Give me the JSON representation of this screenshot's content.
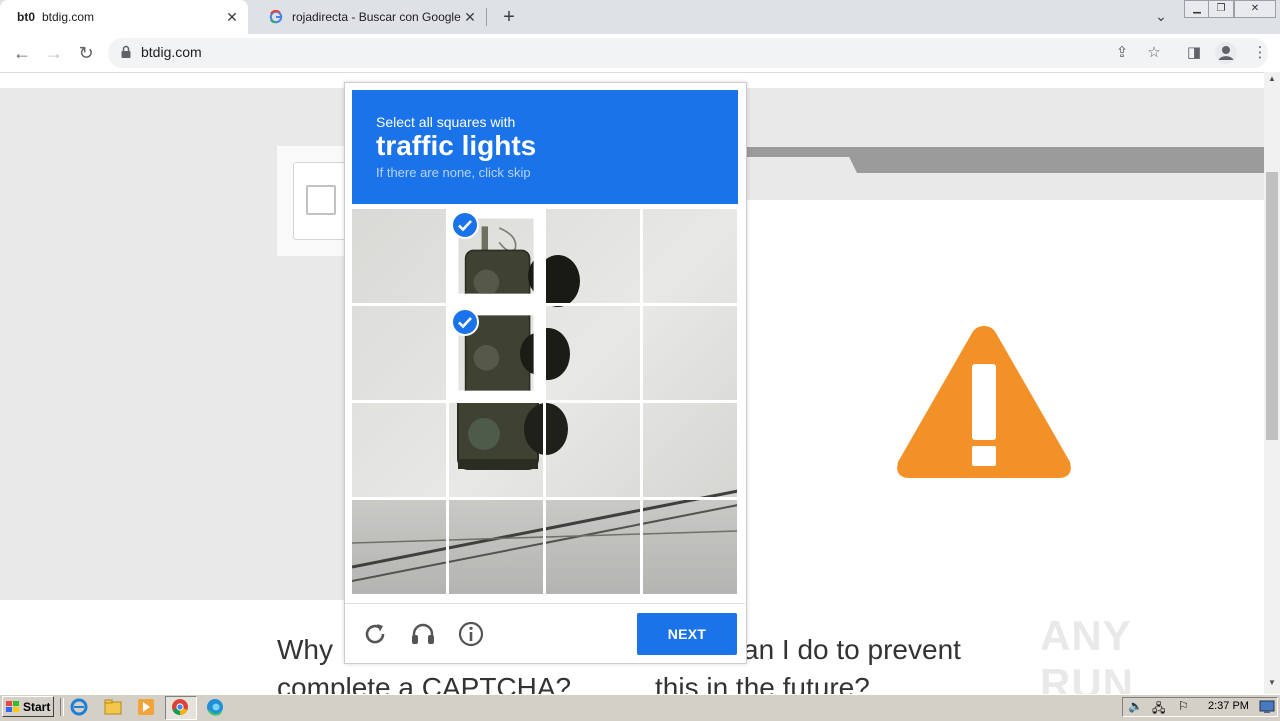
{
  "browser": {
    "tabs": [
      {
        "favicon": "bt0",
        "title": "btdig.com",
        "active": true
      },
      {
        "favicon": "google-g",
        "title": "rojadirecta - Buscar con Google",
        "active": false
      }
    ],
    "new_tab": "+",
    "address": "btdig.com"
  },
  "page": {
    "question1_line1": "Why",
    "question1_line2": "complete a CAPTCHA?",
    "question2_line1": "can I do to prevent",
    "question2_line2": "this in the future?",
    "watermark": "ANY RUN"
  },
  "captcha": {
    "instruction": "Select all squares with",
    "target": "traffic lights",
    "hint": "If there are none, click skip",
    "selected_tiles": [
      1,
      5
    ],
    "next_label": "NEXT",
    "icons": [
      "reload-icon",
      "audio-icon",
      "info-icon"
    ],
    "accent_color": "#1a73e8"
  },
  "taskbar": {
    "start_label": "Start",
    "time": "2:37 PM"
  }
}
